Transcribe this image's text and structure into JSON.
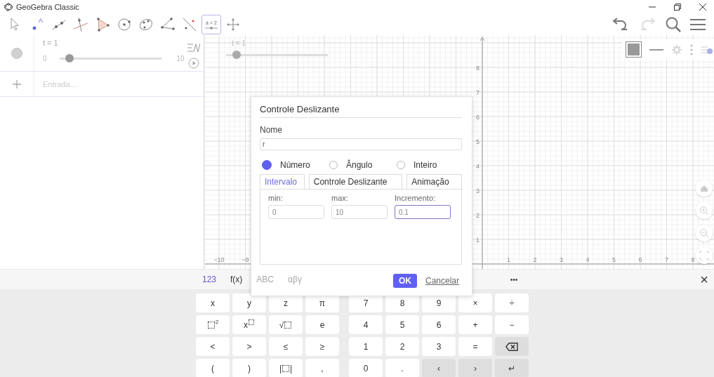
{
  "window": {
    "title": "GeoGebra Classic"
  },
  "toolbar": {
    "tools": [
      {
        "kind": "move",
        "selected": false
      },
      {
        "kind": "point",
        "label": "A",
        "selected": false
      },
      {
        "kind": "line",
        "selected": false
      },
      {
        "kind": "perpendicular",
        "selected": false
      },
      {
        "kind": "polygon",
        "selected": false
      },
      {
        "kind": "circle",
        "selected": false
      },
      {
        "kind": "ellipse",
        "selected": false
      },
      {
        "kind": "angle",
        "selected": false
      },
      {
        "kind": "reflect",
        "selected": false
      },
      {
        "kind": "slider",
        "label": "a = 2",
        "selected": true
      },
      {
        "kind": "move-view",
        "selected": false
      }
    ]
  },
  "algebra": {
    "items": [
      {
        "kind": "slider",
        "visible": true,
        "definition": "t = 1",
        "min": "0",
        "max": "10",
        "level": 0.1
      }
    ],
    "input": {
      "placeholder": "Entrada..."
    }
  },
  "graphics": {
    "slider": {
      "label": "t = 1",
      "level": 0.1
    },
    "x_ticks_negative": [
      "−10",
      "−9"
    ],
    "x_ticks": [
      "1",
      "2",
      "3",
      "4",
      "5",
      "6",
      "7",
      "8"
    ],
    "y_ticks": [
      "8",
      "7",
      "6",
      "5",
      "4",
      "3",
      "2",
      "1"
    ]
  },
  "dialog": {
    "title": "Controle Deslizante",
    "name_label": "Nome",
    "name_value": "r",
    "types": [
      {
        "label": "Número",
        "selected": true
      },
      {
        "label": "Ângulo",
        "selected": false
      },
      {
        "label": "Inteiro",
        "selected": false
      }
    ],
    "tabs": [
      {
        "label": "Intervalo",
        "selected": true
      },
      {
        "label": "Controle Deslizante",
        "selected": false
      },
      {
        "label": "Animação",
        "selected": false
      }
    ],
    "fields": [
      {
        "label": "min:",
        "value": "0",
        "focused": false
      },
      {
        "label": "max:",
        "value": "10",
        "focused": false
      },
      {
        "label": "Incremento:",
        "value": "0.1",
        "focused": true
      }
    ],
    "ok": "OK",
    "cancel": "Cancelar"
  },
  "keyboard": {
    "tabs": [
      {
        "label": "123",
        "selected": true,
        "dimmed": false
      },
      {
        "label": "f(x)",
        "selected": false,
        "dimmed": false
      },
      {
        "label": "ABC",
        "selected": false,
        "dimmed": true
      },
      {
        "label": "αβγ",
        "selected": false,
        "dimmed": true
      }
    ],
    "more": "•••",
    "close": "×",
    "rows": [
      [
        {
          "kind": "char",
          "label": "x"
        },
        {
          "kind": "char",
          "label": "y"
        },
        {
          "kind": "char",
          "label": "z"
        },
        {
          "kind": "char",
          "label": "π"
        },
        {
          "kind": "char",
          "label": "7"
        },
        {
          "kind": "char",
          "label": "8"
        },
        {
          "kind": "char",
          "label": "9"
        },
        {
          "kind": "char",
          "label": "×"
        },
        {
          "kind": "char",
          "label": "÷"
        }
      ],
      [
        {
          "kind": "square",
          "sup": "2"
        },
        {
          "kind": "power",
          "base": "x"
        },
        {
          "kind": "sqrt",
          "sign": "√"
        },
        {
          "kind": "char",
          "label": "e"
        },
        {
          "kind": "char",
          "label": "4"
        },
        {
          "kind": "char",
          "label": "5"
        },
        {
          "kind": "char",
          "label": "6"
        },
        {
          "kind": "char",
          "label": "+"
        },
        {
          "kind": "char",
          "label": "−"
        }
      ],
      [
        {
          "kind": "char",
          "label": "<"
        },
        {
          "kind": "char",
          "label": ">"
        },
        {
          "kind": "char",
          "label": "≤"
        },
        {
          "kind": "char",
          "label": "≥"
        },
        {
          "kind": "char",
          "label": "1"
        },
        {
          "kind": "char",
          "label": "2"
        },
        {
          "kind": "char",
          "label": "3"
        },
        {
          "kind": "char",
          "label": "="
        },
        {
          "kind": "backspace"
        }
      ],
      [
        {
          "kind": "char",
          "label": "("
        },
        {
          "kind": "char",
          "label": ")"
        },
        {
          "kind": "abs",
          "left": "|",
          "right": "|"
        },
        {
          "kind": "char",
          "label": ","
        },
        {
          "kind": "char",
          "label": "0"
        },
        {
          "kind": "char",
          "label": "."
        },
        {
          "kind": "action",
          "label": "‹"
        },
        {
          "kind": "action",
          "label": "›"
        },
        {
          "kind": "action",
          "label": "↵"
        }
      ]
    ]
  }
}
